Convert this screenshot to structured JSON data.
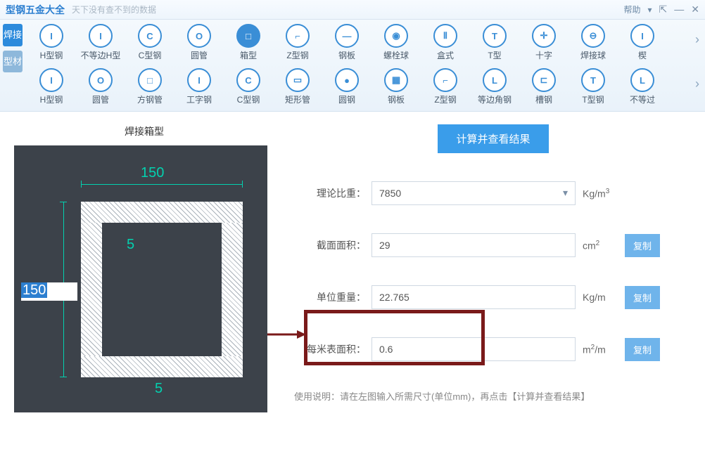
{
  "titlebar": {
    "app_title": "型钢五金大全",
    "tagline": "天下没有查不到的数据",
    "help_label": "帮助"
  },
  "sidebar": {
    "tab_weld": "焊接",
    "tab_profile": "型材"
  },
  "row1": [
    {
      "icon": "I",
      "label": "H型钢"
    },
    {
      "icon": "I",
      "label": "不等边H型"
    },
    {
      "icon": "C",
      "label": "C型钢"
    },
    {
      "icon": "O",
      "label": "圆管"
    },
    {
      "icon": "□",
      "label": "箱型",
      "active": true
    },
    {
      "icon": "⌐",
      "label": "Z型钢"
    },
    {
      "icon": "—",
      "label": "钢板"
    },
    {
      "icon": "◉",
      "label": "螺栓球"
    },
    {
      "icon": "Ⅱ",
      "label": "盒式"
    },
    {
      "icon": "T",
      "label": "T型"
    },
    {
      "icon": "✛",
      "label": "十字"
    },
    {
      "icon": "⊖",
      "label": "焊接球"
    },
    {
      "icon": "I",
      "label": "楔"
    }
  ],
  "row2": [
    {
      "icon": "I",
      "label": "H型钢"
    },
    {
      "icon": "O",
      "label": "圆管"
    },
    {
      "icon": "□",
      "label": "方钢管"
    },
    {
      "icon": "I",
      "label": "工字钢"
    },
    {
      "icon": "C",
      "label": "C型钢"
    },
    {
      "icon": "▭",
      "label": "矩形管"
    },
    {
      "icon": "●",
      "label": "圆钢"
    },
    {
      "icon": "▦",
      "label": "钢板"
    },
    {
      "icon": "⌐",
      "label": "Z型钢"
    },
    {
      "icon": "L",
      "label": "等边角钢"
    },
    {
      "icon": "⊏",
      "label": "槽钢"
    },
    {
      "icon": "T",
      "label": "T型钢"
    },
    {
      "icon": "L",
      "label": "不等过"
    }
  ],
  "diagram": {
    "title": "焊接箱型",
    "dim_top": "150",
    "dim_left": "150",
    "dim_t1": "5",
    "dim_t2": "5"
  },
  "form": {
    "calc_button": "计算并查看结果",
    "density_label": "理论比重：",
    "density_value": "7850",
    "density_unit": "Kg/m³",
    "area_label": "截面面积：",
    "area_value": "29",
    "area_unit": "cm²",
    "weight_label": "单位重量：",
    "weight_value": "22.765",
    "weight_unit": "Kg/m",
    "surface_label": "每米表面积：",
    "surface_value": "0.6",
    "surface_unit": "m²/m",
    "copy_label": "复制",
    "instructions": "使用说明：请在左图输入所需尺寸(单位mm)，再点击【计算并查看结果】"
  }
}
